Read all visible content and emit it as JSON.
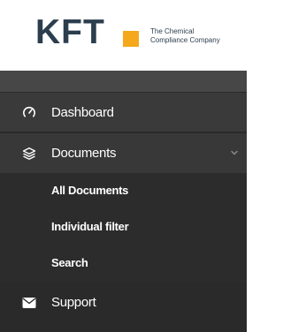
{
  "logo": {
    "wordmark": "KFT",
    "tagline_line1": "The Chemical",
    "tagline_line2": "Compliance Company",
    "brand_accent": "#f5a81c",
    "brand_text": "#2c3e4e"
  },
  "menu": {
    "items": [
      {
        "label": "Dashboard",
        "icon": "dashboard-gauge-icon"
      },
      {
        "label": "Documents",
        "icon": "layers-icon",
        "expanded": true
      },
      {
        "label": "Support",
        "icon": "envelope-icon"
      }
    ],
    "documents_submenu": [
      {
        "label": "All Documents"
      },
      {
        "label": "Individual filter"
      },
      {
        "label": "Search"
      }
    ]
  }
}
